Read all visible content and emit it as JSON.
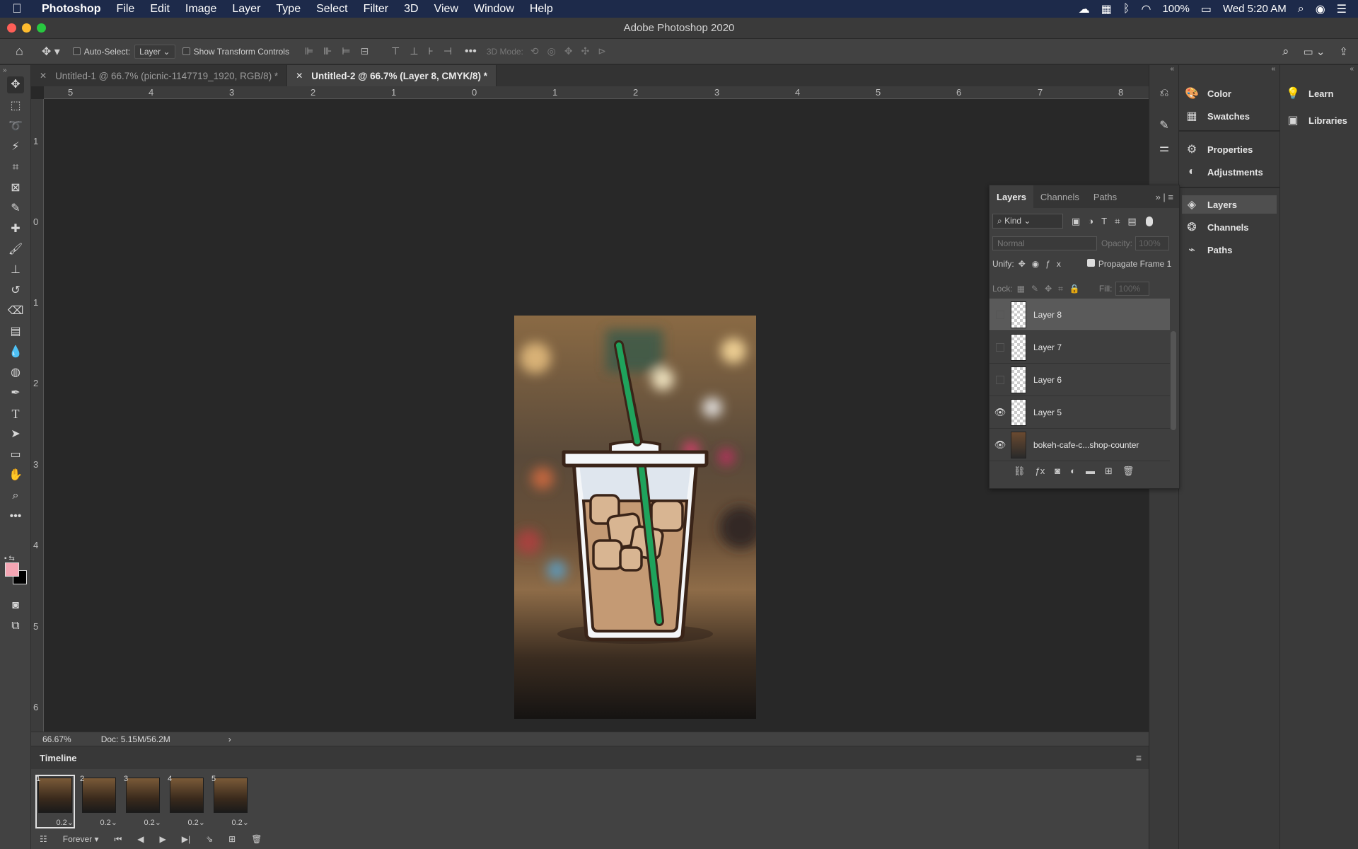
{
  "menubar": {
    "app": "Photoshop",
    "items": [
      "File",
      "Edit",
      "Image",
      "Layer",
      "Type",
      "Select",
      "Filter",
      "3D",
      "View",
      "Window",
      "Help"
    ],
    "battery": "100%",
    "clock": "Wed 5:20 AM"
  },
  "window": {
    "title": "Adobe Photoshop 2020"
  },
  "options": {
    "auto_select_label": "Auto-Select:",
    "auto_select_value": "Layer",
    "show_transform_label": "Show Transform Controls",
    "mode_3d_label": "3D Mode:"
  },
  "tabs": [
    {
      "label": "Untitled-1 @ 66.7% (picnic-1147719_1920, RGB/8) *"
    },
    {
      "label": "Untitled-2 @ 66.7% (Layer 8, CMYK/8) *"
    }
  ],
  "rulers": {
    "h": [
      "5",
      "4",
      "3",
      "2",
      "1",
      "0",
      "1",
      "2",
      "3",
      "4",
      "5",
      "6",
      "7",
      "8"
    ],
    "v": [
      "1",
      "0",
      "1",
      "2",
      "3",
      "4",
      "5",
      "6"
    ]
  },
  "status": {
    "zoom": "66.67%",
    "doc": "Doc: 5.15M/56.2M",
    "arrow": "›"
  },
  "timeline": {
    "title": "Timeline",
    "frames": [
      {
        "num": "1",
        "dur": "0.2"
      },
      {
        "num": "2",
        "dur": "0.2"
      },
      {
        "num": "3",
        "dur": "0.2"
      },
      {
        "num": "4",
        "dur": "0.2"
      },
      {
        "num": "5",
        "dur": "0.2"
      }
    ],
    "loop": "Forever",
    "selected_frame": "1"
  },
  "dock_mid": {
    "items": [
      "Color",
      "Swatches",
      "Properties",
      "Adjustments",
      "Layers",
      "Channels",
      "Paths"
    ]
  },
  "dock_right": {
    "items": [
      "Learn",
      "Libraries"
    ]
  },
  "layers_panel": {
    "tabs": [
      "Layers",
      "Channels",
      "Paths"
    ],
    "kind": "Kind",
    "blend": "Normal",
    "opacity_label": "Opacity:",
    "opacity_value": "100%",
    "unify_label": "Unify:",
    "propagate_label": "Propagate Frame 1",
    "lock_label": "Lock:",
    "fill_label": "Fill:",
    "fill_value": "100%",
    "layers": [
      {
        "name": "Layer 8",
        "visible": false,
        "selected": true
      },
      {
        "name": "Layer 7",
        "visible": false
      },
      {
        "name": "Layer 6",
        "visible": false
      },
      {
        "name": "Layer 5",
        "visible": true
      },
      {
        "name": "bokeh-cafe-c...shop-counter",
        "visible": true
      }
    ]
  },
  "colors": {
    "foreground": "#f4a6b4",
    "background": "#000000",
    "straw": "#1fa35c",
    "coffee": "#c49a74"
  }
}
